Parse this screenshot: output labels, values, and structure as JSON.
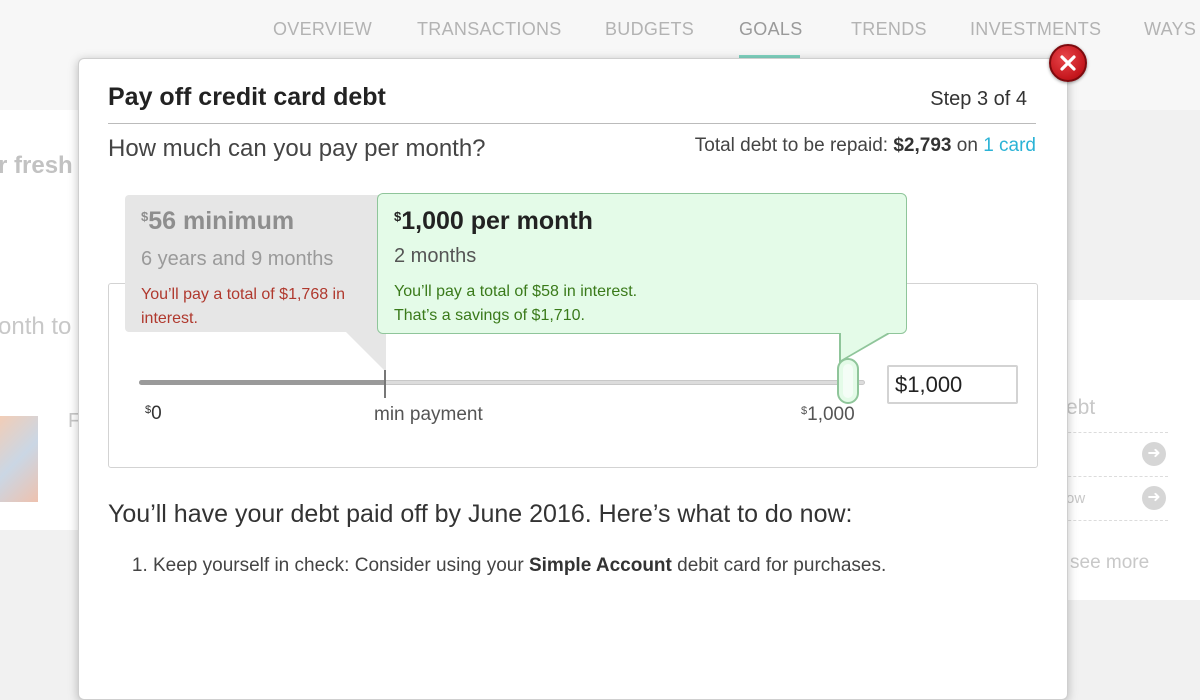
{
  "nav": {
    "items": [
      "OVERVIEW",
      "TRANSACTIONS",
      "BUDGETS",
      "GOALS",
      "TRENDS",
      "INVESTMENTS",
      "WAYS"
    ],
    "active": "GOALS"
  },
  "background": {
    "fresh_text": "r fresh",
    "month_text": "onth to",
    "side_letter": "F",
    "debt_text": "ebt",
    "ow_text": "ow",
    "see_more": "see more"
  },
  "modal": {
    "title": "Pay off credit card debt",
    "step": "Step 3 of 4",
    "question": "How much can you pay per month?",
    "total_debt_label": "Total debt to be repaid:",
    "total_debt_amount": "$2,793",
    "on_text": "on",
    "card_link": "1 card",
    "minimum": {
      "currency": "$",
      "amount": "56 minimum",
      "duration": "6 years and 9 months",
      "interest": "You’ll pay a total of $1,768 in interest."
    },
    "selected": {
      "currency": "$",
      "amount": "1,000 per month",
      "duration": "2 months",
      "interest_line1": "You’ll pay a total of $58 in interest.",
      "interest_line2": "That’s a savings of $1,710."
    },
    "slider": {
      "label_zero_currency": "$",
      "label_zero": "0",
      "label_min": "min payment",
      "label_max_currency": "$",
      "label_max": "1,000",
      "input_value": "$1,000",
      "value_fraction": 1.0,
      "min_fraction": 0.34
    },
    "payoff_line": "You’ll have your debt paid off by June 2016. Here’s what to do now:",
    "steps": [
      {
        "before": "Keep yourself in check: Consider using your ",
        "bold": "Simple Account",
        "after": " debit card for purchases."
      }
    ]
  },
  "colors": {
    "accent_teal": "#7fd3c0",
    "link_blue": "#2bb3d6",
    "close_red": "#c4161c",
    "bubble_green": "#e4fbe8",
    "interest_red": "#b0392e",
    "interest_green": "#3a7a1a"
  }
}
